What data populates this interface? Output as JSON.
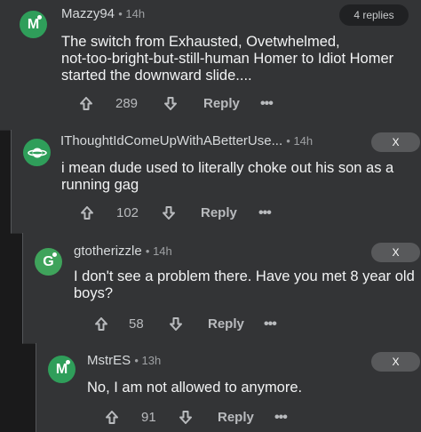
{
  "comments": [
    {
      "username": "Mazzy94",
      "time": "14h",
      "avatar_letter": "M",
      "avatar_color": "#2f9e5a",
      "pill": "4 replies",
      "lines": [
        "The switch from Exhausted, Ovetwhelmed,",
        "not-too-bright-but-still-human Homer to Idiot Homer",
        "started the downward slide...."
      ],
      "votes": "289",
      "reply": "Reply",
      "more": "•••"
    },
    {
      "username": "IThoughtIdComeUpWithABetterUse...",
      "time": "14h",
      "avatar_icon": "planet-icon",
      "avatar_color": "#2f9e5a",
      "pill": "X",
      "lines": [
        "i mean dude used to literally choke out his son as a",
        "running gag"
      ],
      "votes": "102",
      "reply": "Reply",
      "more": "•••"
    },
    {
      "username": "gtotherizzle",
      "time": "14h",
      "avatar_letter": "G",
      "avatar_color": "#3fa35b",
      "pill": "X",
      "lines": [
        "I don't see a problem there. Have you met 8 year old",
        "boys?"
      ],
      "votes": "58",
      "reply": "Reply",
      "more": "•••"
    },
    {
      "username": "MstrES",
      "time": "13h",
      "avatar_letter": "M",
      "avatar_color": "#2f9e5a",
      "pill": "X",
      "lines": [
        "No, I am not allowed to anymore."
      ],
      "votes": "91",
      "reply": "Reply",
      "more": "•••"
    }
  ]
}
